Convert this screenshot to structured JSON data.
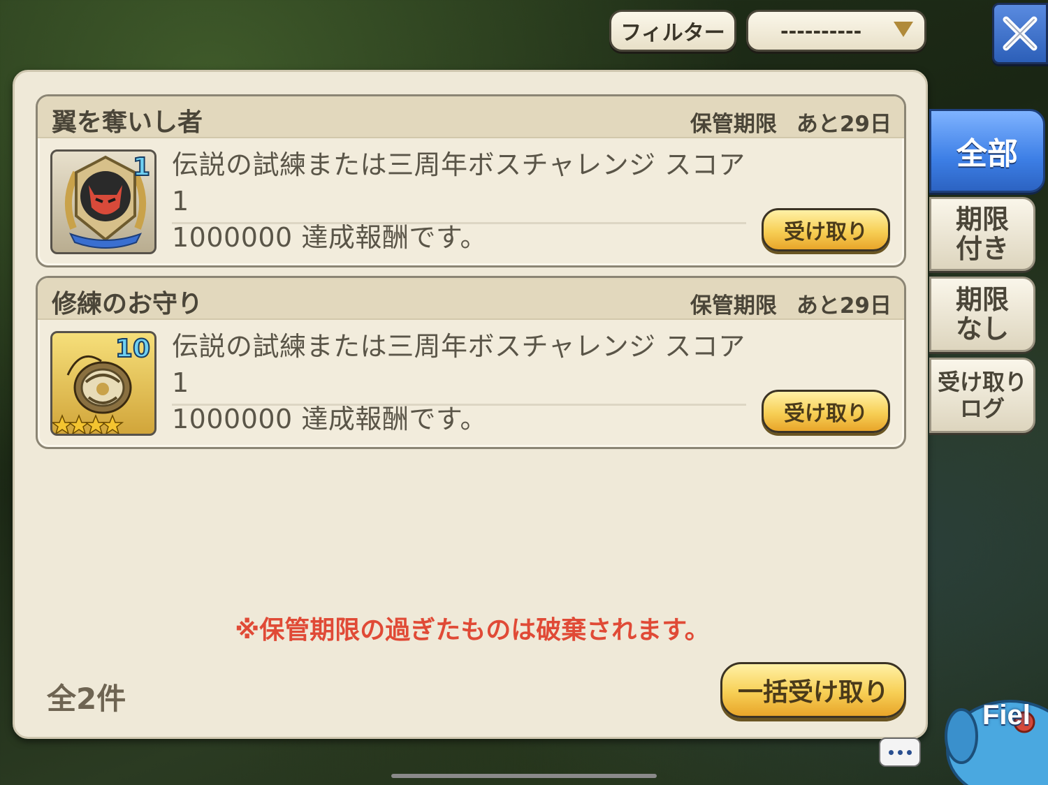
{
  "header": {
    "filter_label": "フィルター",
    "filter_value": "----------"
  },
  "tabs": [
    {
      "label": "全部",
      "active": true
    },
    {
      "label": "期限\n付き",
      "active": false
    },
    {
      "label": "期限\nなし",
      "active": false
    },
    {
      "label": "受け取り\nログ",
      "active": false
    }
  ],
  "items": [
    {
      "title": "翼を奪いし者",
      "expiry_label": "保管期限",
      "expiry_value": "あと29日",
      "quantity": "1",
      "description_line1": "伝説の試練または三周年ボスチャレンジ スコア　1",
      "description_line2": "1000000 達成報酬です。",
      "icon": "demon-emblem-icon",
      "claim_label": "受け取り"
    },
    {
      "title": "修練のお守り",
      "expiry_label": "保管期限",
      "expiry_value": "あと29日",
      "quantity": "10",
      "stars": 4,
      "description_line1": "伝説の試練または三周年ボスチャレンジ スコア　1",
      "description_line2": "1000000 達成報酬です。",
      "icon": "amulet-icon",
      "claim_label": "受け取り"
    }
  ],
  "warning": "※保管期限の過ぎたものは破棄されます。",
  "total": "全2件",
  "bulk_claim_label": "一括受け取り",
  "field_badge_text": "Fiel",
  "colors": {
    "accent_blue": "#3d7fe6",
    "warning_red": "#e04a36",
    "button_gold": "#f7cf55"
  }
}
